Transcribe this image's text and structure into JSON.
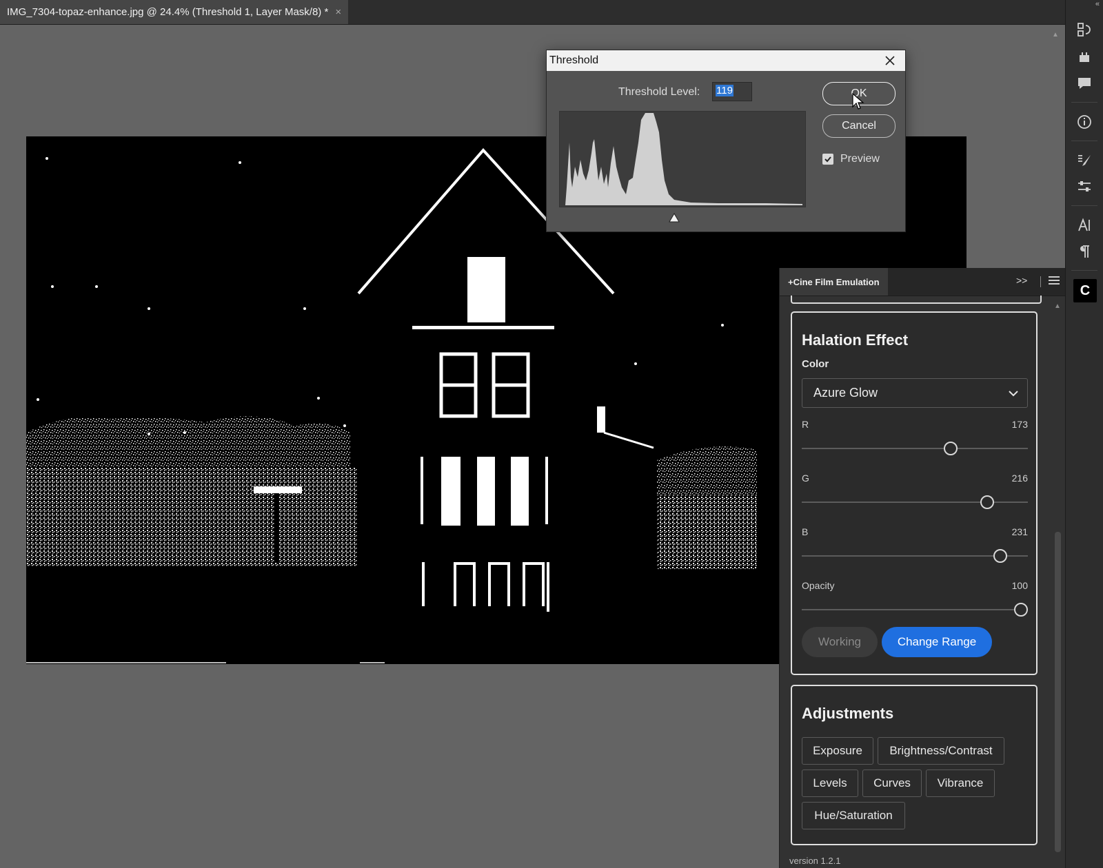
{
  "document": {
    "tab_title": "IMG_7304-topaz-enhance.jpg @ 24.4% (Threshold 1, Layer Mask/8) *",
    "close_glyph": "×"
  },
  "threshold_dialog": {
    "title": "Threshold",
    "level_label": "Threshold Level:",
    "level_value": "119",
    "ok_label": "OK",
    "cancel_label": "Cancel",
    "preview_label": "Preview",
    "preview_checked": true
  },
  "plugin_panel": {
    "tab_label": "+Cine Film Emulation",
    "halation": {
      "title": "Halation Effect",
      "color_label": "Color",
      "color_value": "Azure Glow",
      "sliders": [
        {
          "label": "R",
          "value": "173",
          "fraction": 0.678
        },
        {
          "label": "G",
          "value": "216",
          "fraction": 0.847
        },
        {
          "label": "B",
          "value": "231",
          "fraction": 0.906
        },
        {
          "label": "Opacity",
          "value": "100",
          "fraction": 1.0
        }
      ],
      "working_label": "Working",
      "change_range_label": "Change Range"
    },
    "adjustments": {
      "title": "Adjustments",
      "buttons": [
        "Exposure",
        "Brightness/Contrast",
        "Levels",
        "Curves",
        "Vibrance",
        "Hue/Saturation"
      ]
    },
    "version": "version 1.2.1"
  },
  "toolstrip": {
    "icons": [
      "history-icon",
      "plugins-icon",
      "comments-icon",
      "info-icon",
      "brush-settings-icon",
      "adjustments-sliders-icon",
      "character-icon",
      "paragraph-icon",
      "cine-plugin-icon"
    ],
    "cine_label": "C"
  },
  "colors": {
    "accent_blue": "#1f6fe0",
    "selection_blue": "#2f78d5",
    "panel_bg": "#323232",
    "canvas_bg": "#646464"
  }
}
